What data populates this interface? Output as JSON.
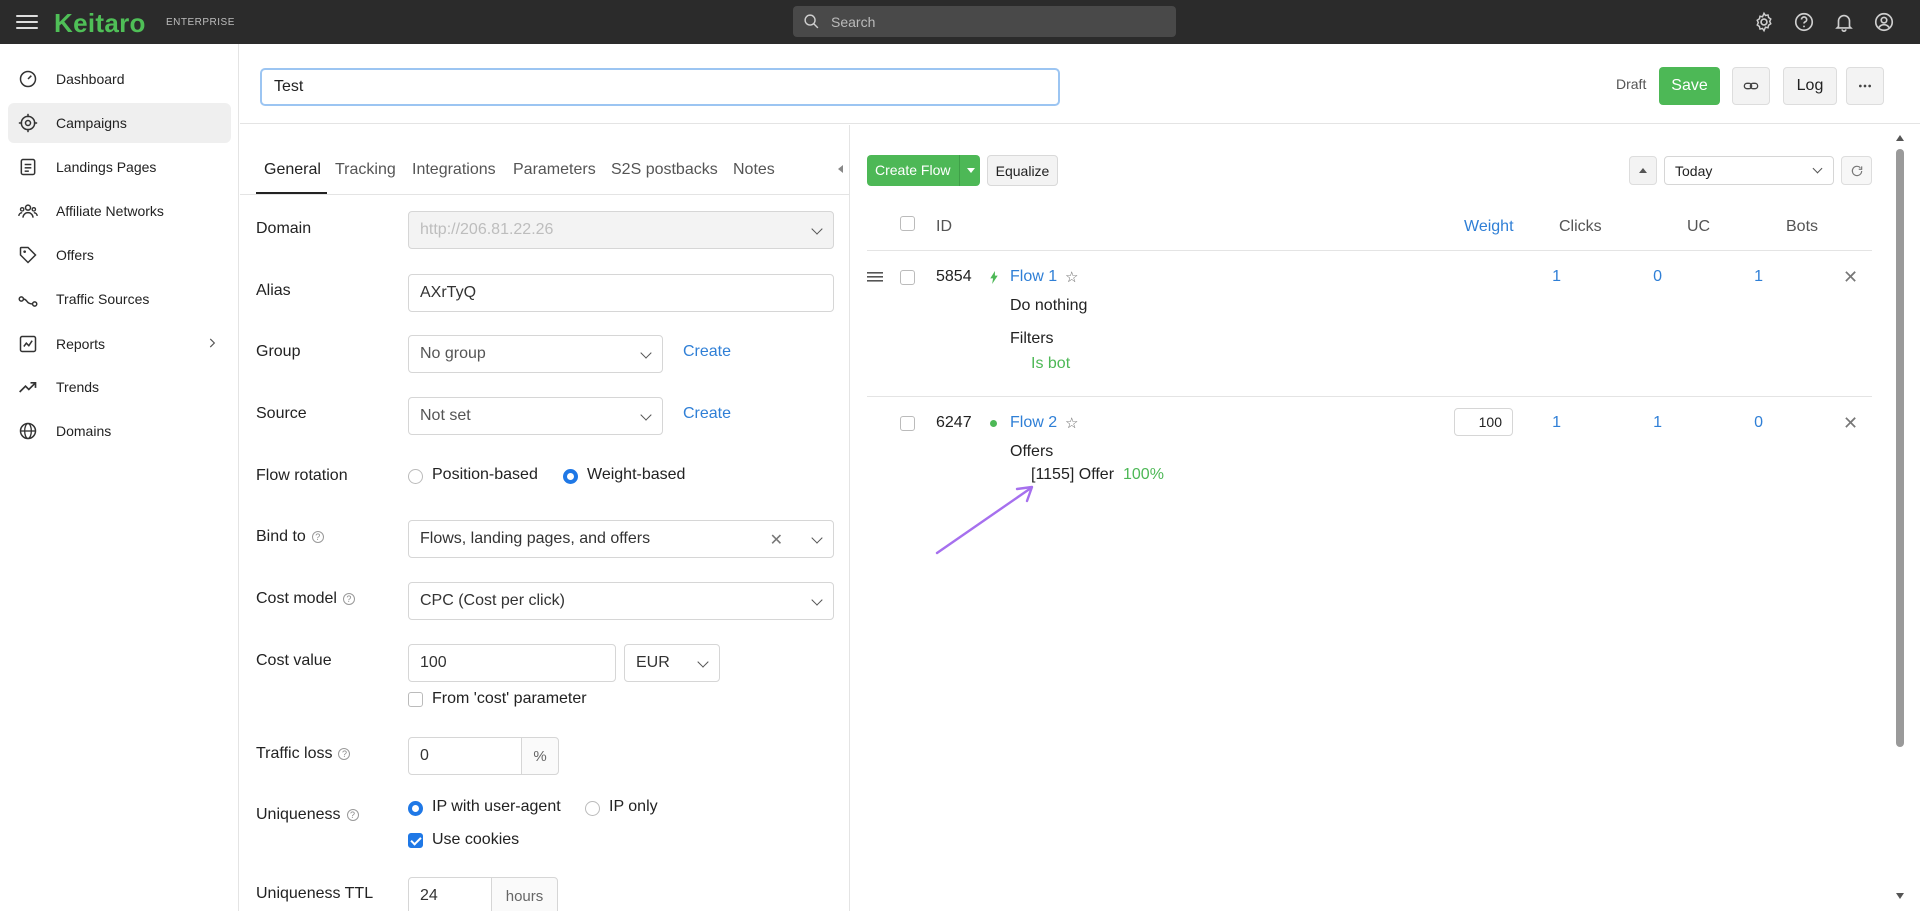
{
  "topbar": {
    "logo": "Keitaro",
    "edition": "ENTERPRISE",
    "search_placeholder": "Search"
  },
  "sidebar": {
    "items": [
      {
        "label": "Dashboard",
        "icon": "dashboard-icon"
      },
      {
        "label": "Campaigns",
        "icon": "campaigns-icon",
        "active": true
      },
      {
        "label": "Landings Pages",
        "icon": "landing-pages-icon"
      },
      {
        "label": "Affiliate Networks",
        "icon": "affiliate-networks-icon"
      },
      {
        "label": "Offers",
        "icon": "offers-icon"
      },
      {
        "label": "Traffic Sources",
        "icon": "traffic-sources-icon"
      },
      {
        "label": "Reports",
        "icon": "reports-icon"
      },
      {
        "label": "Trends",
        "icon": "trends-icon"
      },
      {
        "label": "Domains",
        "icon": "domains-icon"
      }
    ]
  },
  "header": {
    "campaign_name": "Test",
    "status": "Draft",
    "save_label": "Save",
    "log_label": "Log"
  },
  "tabs": [
    "General",
    "Tracking",
    "Integrations",
    "Parameters",
    "S2S postbacks",
    "Notes"
  ],
  "form": {
    "domain_label": "Domain",
    "domain_value": "http://206.81.22.26",
    "alias_label": "Alias",
    "alias_value": "AXrTyQ",
    "group_label": "Group",
    "group_value": "No group",
    "create_label": "Create",
    "source_label": "Source",
    "source_value": "Not set",
    "rotation_label": "Flow rotation",
    "rotation_position": "Position-based",
    "rotation_weight": "Weight-based",
    "bind_label": "Bind to",
    "bind_value": "Flows, landing pages, and offers",
    "cost_model_label": "Cost model",
    "cost_model_value": "CPC (Cost per click)",
    "cost_value_label": "Cost value",
    "cost_value": "100",
    "currency": "EUR",
    "from_cost_label": "From 'cost' parameter",
    "traffic_loss_label": "Traffic loss",
    "traffic_loss_value": "0",
    "percent": "%",
    "uniqueness_label": "Uniqueness",
    "uniq_ip_ua": "IP with user-agent",
    "uniq_ip_only": "IP only",
    "use_cookies": "Use cookies",
    "uniqueness_ttl_label": "Uniqueness TTL",
    "uniqueness_ttl_value": "24",
    "hours": "hours"
  },
  "flows": {
    "create_label": "Create Flow",
    "equalize_label": "Equalize",
    "date_range": "Today",
    "columns": {
      "id": "ID",
      "weight": "Weight",
      "clicks": "Clicks",
      "uc": "UC",
      "bots": "Bots"
    },
    "rows": [
      {
        "id": "5854",
        "name": "Flow 1",
        "action": "Do nothing",
        "section": "Filters",
        "detail": "Is bot",
        "clicks": "1",
        "uc": "0",
        "bots": "1"
      },
      {
        "id": "6247",
        "name": "Flow 2",
        "section": "Offers",
        "offer": "[1155] Offer",
        "share": "100%",
        "weight": "100",
        "clicks": "1",
        "uc": "1",
        "bots": "0"
      }
    ]
  },
  "colors": {
    "brand_green": "#4fbf57",
    "link_blue": "#2f7fd6",
    "annotation_purple": "#a670ee"
  }
}
